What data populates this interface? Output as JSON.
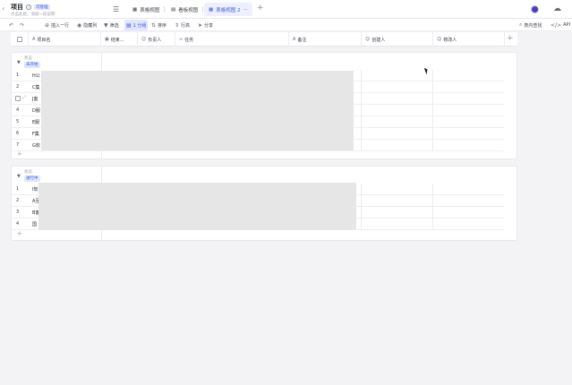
{
  "header": {
    "title": "项目",
    "badge": "可管理",
    "subtitle": "点击此处，添加一段说明",
    "tabs": [
      {
        "label": "表格视图"
      },
      {
        "label": "看板视图"
      },
      {
        "label": "表格视图 2"
      }
    ],
    "active_tab_more": "···",
    "add_view": "+"
  },
  "toolbar": {
    "items": [
      {
        "label": "插入一行"
      },
      {
        "label": "隐藏列"
      },
      {
        "label": "筛选"
      },
      {
        "label": "1 分组"
      },
      {
        "label": "排序"
      },
      {
        "label": "行高"
      },
      {
        "label": "分享"
      }
    ],
    "search": "表内查找",
    "api": "API"
  },
  "columns": [
    {
      "label": "项目名"
    },
    {
      "label": "结束..."
    },
    {
      "label": "负责人"
    },
    {
      "label": "任务"
    },
    {
      "label": "备注"
    },
    {
      "label": "创建人"
    },
    {
      "label": "修改人"
    }
  ],
  "groups": [
    {
      "label": "状态",
      "value": "未开始",
      "badge_bg": "#e1e5ff",
      "badge_fg": "#3c5adb",
      "rows": [
        {
          "num": "1",
          "name": "H公"
        },
        {
          "num": "2",
          "name": "C集"
        },
        {
          "num": "3",
          "name": "J客"
        },
        {
          "num": "4",
          "name": "D服"
        },
        {
          "num": "5",
          "name": "E服"
        },
        {
          "num": "6",
          "name": "F集"
        },
        {
          "num": "7",
          "name": "G软"
        }
      ],
      "add": "+"
    },
    {
      "label": "状态",
      "value": "进行中",
      "badge_bg": "#e1e5ff",
      "badge_fg": "#3c5adb",
      "rows": [
        {
          "num": "1",
          "name": "I软"
        },
        {
          "num": "2",
          "name": "A互"
        },
        {
          "num": "3",
          "name": "B客"
        },
        {
          "num": "4",
          "name": "国"
        }
      ],
      "add": "+"
    }
  ]
}
